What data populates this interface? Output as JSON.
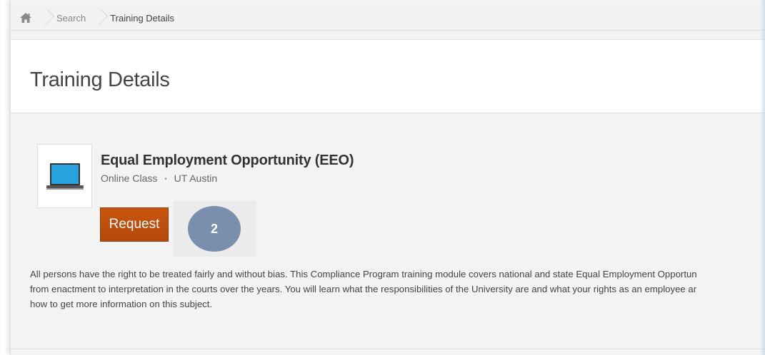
{
  "breadcrumb": {
    "home_icon": "home-icon",
    "items": [
      "Search",
      "Training Details"
    ]
  },
  "page": {
    "title": "Training Details"
  },
  "course": {
    "thumbnail_icon": "laptop-icon",
    "title": "Equal Employment Opportunity (EEO)",
    "type": "Online Class",
    "provider": "UT Austin",
    "request_label": "Request",
    "step_number": "2",
    "description_lines": [
      "All persons have the right to be treated fairly and without bias. This Compliance Program training module covers national and state Equal Employment Opportun",
      "from enactment to interpretation in the courts over the years. You will learn what the responsibilities of the University are and what your rights as an employee ar",
      "how to get more information on this subject."
    ]
  },
  "colors": {
    "request_button": "#b84a0b",
    "step_badge": "#7a8fab",
    "laptop_screen": "#29a3e0"
  }
}
